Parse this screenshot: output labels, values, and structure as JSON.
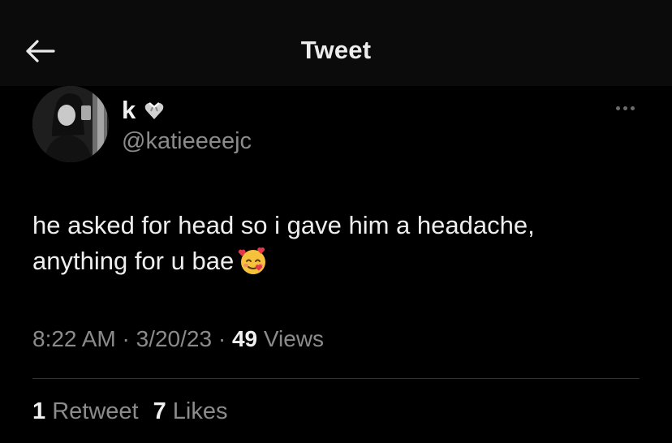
{
  "header": {
    "title": "Tweet",
    "back_icon": "arrow-left-icon"
  },
  "author": {
    "display_name": "k",
    "name_emoji": "heart-with-ribbon-icon",
    "handle": "@katieeeejc",
    "avatar": "profile-photo"
  },
  "more_icon": "ellipsis-icon",
  "tweet": {
    "line1": "he asked for head so i gave him a headache,",
    "line2": "anything for u bae",
    "emoji": "smiling-face-with-hearts-icon"
  },
  "meta": {
    "time": "8:22 AM",
    "sep1": " · ",
    "date": "3/20/23",
    "sep2": " · ",
    "views_count": "49",
    "views_label": " Views"
  },
  "stats": {
    "retweets_count": "1",
    "retweets_label": " Retweet",
    "likes_count": "7",
    "likes_label": " Likes"
  },
  "colors": {
    "background": "#000000",
    "header_bg": "#0b0b0b",
    "primary_text": "#e7e9ea",
    "secondary_text": "#8b8b8b",
    "divider": "#2f3336"
  }
}
